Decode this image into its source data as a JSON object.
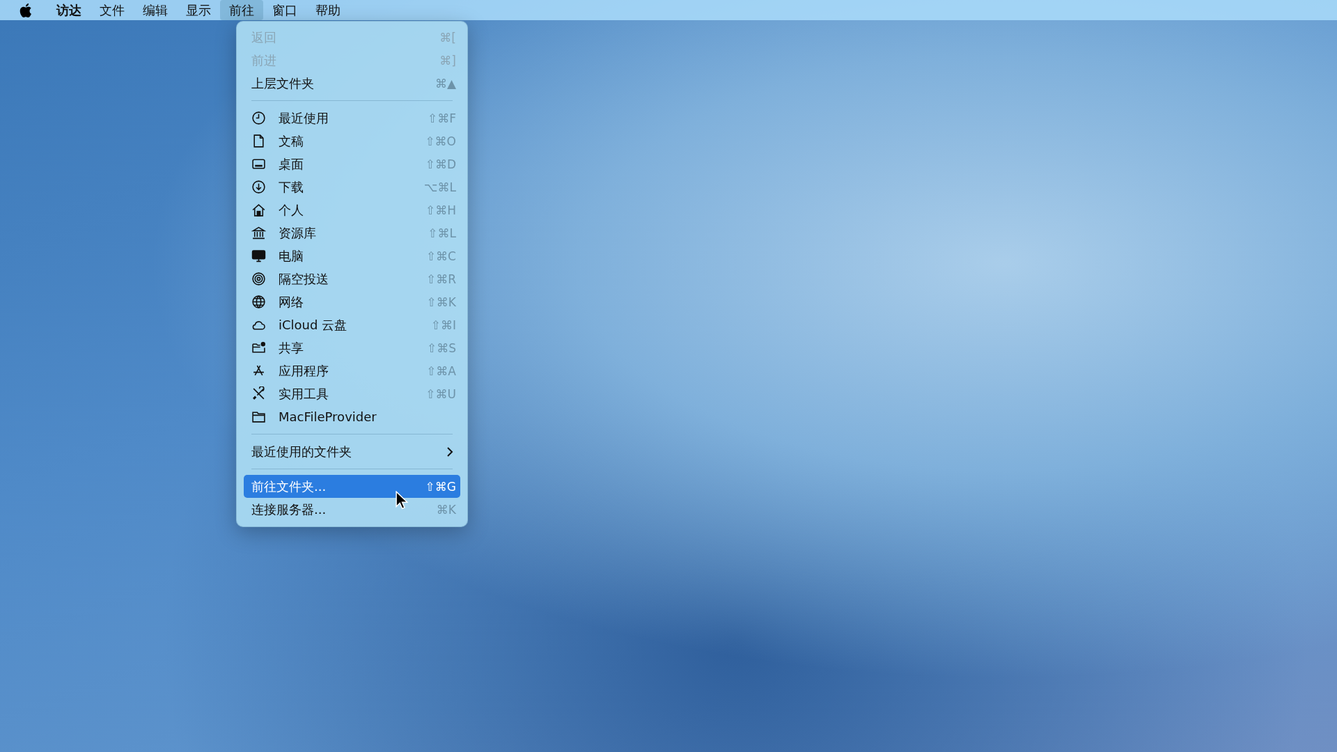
{
  "menu_bar": [
    {
      "label": "访达",
      "selected": false,
      "kind": "app"
    },
    {
      "label": "文件",
      "selected": false,
      "kind": "menu"
    },
    {
      "label": "编辑",
      "selected": false,
      "kind": "menu"
    },
    {
      "label": "显示",
      "selected": false,
      "kind": "menu"
    },
    {
      "label": "前往",
      "selected": true,
      "kind": "menu"
    },
    {
      "label": "窗口",
      "selected": false,
      "kind": "menu"
    },
    {
      "label": "帮助",
      "selected": false,
      "kind": "menu"
    }
  ],
  "dropdown": {
    "groups": [
      {
        "items": [
          {
            "kind": "plain",
            "label": "返回",
            "shortcut": "⌘[",
            "disabled": true,
            "selected": false
          },
          {
            "kind": "plain",
            "label": "前进",
            "shortcut": "⌘]",
            "disabled": true,
            "selected": false
          },
          {
            "kind": "plain",
            "label": "上层文件夹",
            "shortcut": "⌘▲",
            "disabled": false,
            "selected": false
          }
        ]
      },
      {
        "items": [
          {
            "kind": "icon",
            "label": "最近使用",
            "shortcut": "⇧⌘F",
            "disabled": false,
            "selected": false
          },
          {
            "kind": "icon",
            "label": "文稿",
            "shortcut": "⇧⌘O",
            "disabled": false,
            "selected": false
          },
          {
            "kind": "icon",
            "label": "桌面",
            "shortcut": "⇧⌘D",
            "disabled": false,
            "selected": false
          },
          {
            "kind": "icon",
            "label": "下载",
            "shortcut": "⌥⌘L",
            "disabled": false,
            "selected": false
          },
          {
            "kind": "icon",
            "label": "个人",
            "shortcut": "⇧⌘H",
            "disabled": false,
            "selected": false
          },
          {
            "kind": "icon",
            "label": "资源库",
            "shortcut": "⇧⌘L",
            "disabled": false,
            "selected": false
          },
          {
            "kind": "icon",
            "label": "电脑",
            "shortcut": "⇧⌘C",
            "disabled": false,
            "selected": false
          },
          {
            "kind": "icon",
            "label": "隔空投送",
            "shortcut": "⇧⌘R",
            "disabled": false,
            "selected": false
          },
          {
            "kind": "icon",
            "label": "网络",
            "shortcut": "⇧⌘K",
            "disabled": false,
            "selected": false
          },
          {
            "kind": "icon",
            "label": "iCloud 云盘",
            "shortcut": "⇧⌘I",
            "disabled": false,
            "selected": false
          },
          {
            "kind": "icon",
            "label": "共享",
            "shortcut": "⇧⌘S",
            "disabled": false,
            "selected": false
          },
          {
            "kind": "icon",
            "label": "应用程序",
            "shortcut": "⇧⌘A",
            "disabled": false,
            "selected": false
          },
          {
            "kind": "icon",
            "label": "实用工具",
            "shortcut": "⇧⌘U",
            "disabled": false,
            "selected": false
          },
          {
            "kind": "icon",
            "label": "MacFileProvider",
            "disabled": false,
            "selected": false
          }
        ]
      },
      {
        "items": [
          {
            "kind": "submenu",
            "label": "最近使用的文件夹",
            "disabled": false,
            "selected": false
          }
        ]
      },
      {
        "items": [
          {
            "kind": "plain",
            "label": "前往文件夹...",
            "shortcut": "⇧⌘G",
            "disabled": false,
            "selected": true
          },
          {
            "kind": "plain",
            "label": "连接服务器...",
            "shortcut": "⌘K",
            "disabled": false,
            "selected": false
          }
        ]
      }
    ]
  }
}
